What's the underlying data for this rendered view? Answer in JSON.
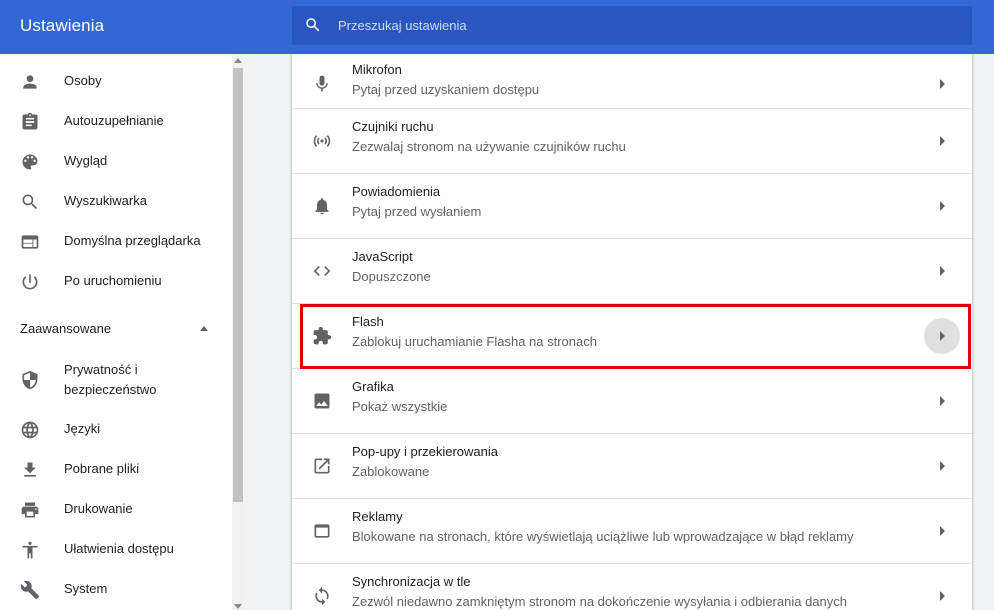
{
  "header": {
    "title": "Ustawienia",
    "search_placeholder": "Przeszukaj ustawienia"
  },
  "sidebar": {
    "items": [
      {
        "label": "Osoby",
        "icon": "person-icon"
      },
      {
        "label": "Autouzupełnianie",
        "icon": "clipboard-icon"
      },
      {
        "label": "Wygląd",
        "icon": "palette-icon"
      },
      {
        "label": "Wyszukiwarka",
        "icon": "search-icon"
      },
      {
        "label": "Domyślna przeglądarka",
        "icon": "browser-icon"
      },
      {
        "label": "Po uruchomieniu",
        "icon": "power-icon"
      }
    ],
    "advanced_label": "Zaawansowane",
    "advanced_items": [
      {
        "label": "Prywatność i bezpieczeństwo",
        "icon": "shield-icon"
      },
      {
        "label": "Języki",
        "icon": "globe-icon"
      },
      {
        "label": "Pobrane pliki",
        "icon": "download-icon"
      },
      {
        "label": "Drukowanie",
        "icon": "printer-icon"
      },
      {
        "label": "Ułatwienia dostępu",
        "icon": "accessibility-icon"
      },
      {
        "label": "System",
        "icon": "wrench-icon"
      }
    ]
  },
  "content": {
    "rows": [
      {
        "title": "Mikrofon",
        "subtitle": "Pytaj przed uzyskaniem dostępu",
        "icon": "microphone-icon"
      },
      {
        "title": "Czujniki ruchu",
        "subtitle": "Zezwalaj stronom na używanie czujników ruchu",
        "icon": "motion-sensor-icon"
      },
      {
        "title": "Powiadomienia",
        "subtitle": "Pytaj przed wysłaniem",
        "icon": "bell-icon"
      },
      {
        "title": "JavaScript",
        "subtitle": "Dopuszczone",
        "icon": "code-icon"
      },
      {
        "title": "Flash",
        "subtitle": "Zablokuj uruchamianie Flasha na stronach",
        "icon": "puzzle-icon"
      },
      {
        "title": "Grafika",
        "subtitle": "Pokaż wszystkie",
        "icon": "image-icon"
      },
      {
        "title": "Pop-upy i przekierowania",
        "subtitle": "Zablokowane",
        "icon": "external-link-icon"
      },
      {
        "title": "Reklamy",
        "subtitle": "Blokowane na stronach, które wyświetlają uciążliwe lub wprowadzające w błąd reklamy",
        "icon": "window-icon"
      },
      {
        "title": "Synchronizacja w tle",
        "subtitle": "Zezwól niedawno zamkniętym stronom na dokończenie wysyłania i odbierania danych",
        "icon": "sync-icon"
      }
    ]
  },
  "colors": {
    "header_bg": "#3367d6",
    "search_bg": "#2a56c0",
    "highlight": "#e00000"
  }
}
